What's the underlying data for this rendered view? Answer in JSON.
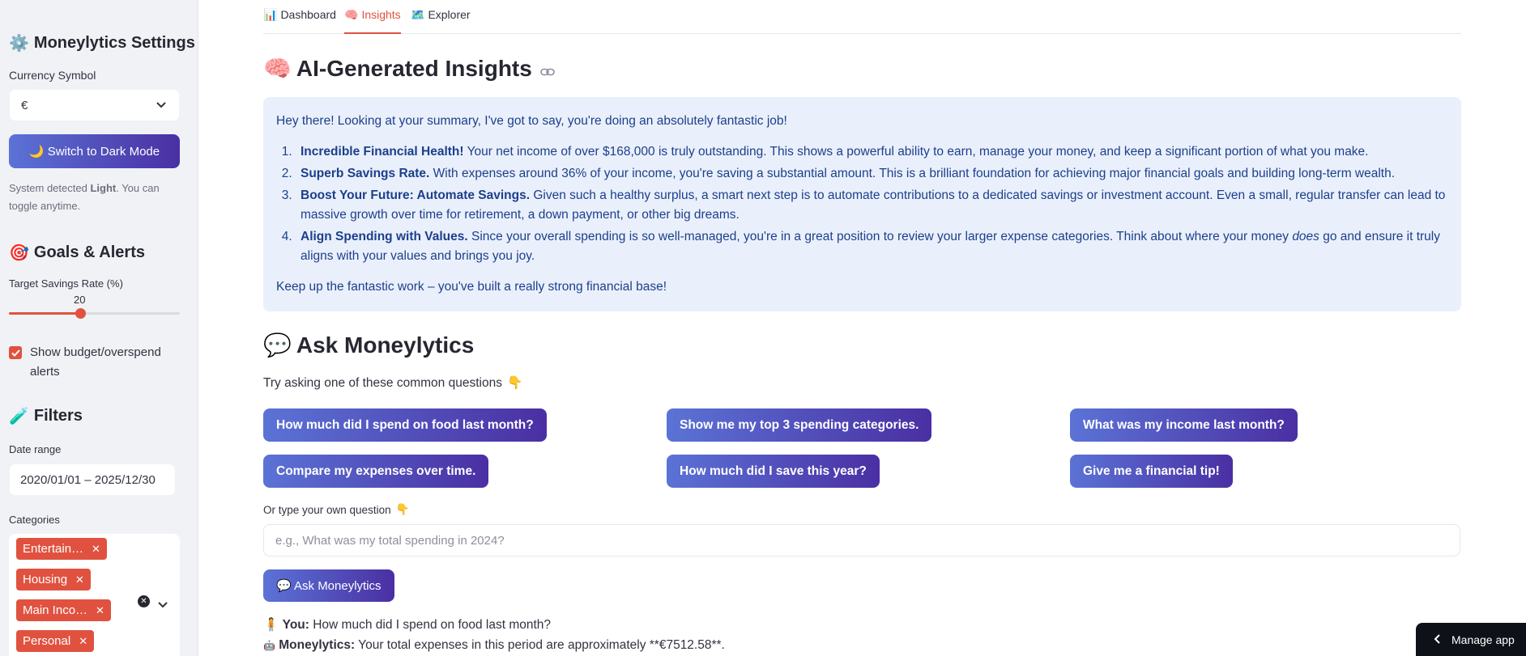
{
  "sidebar": {
    "settings_title": "Moneylytics Settings",
    "currency_label": "Currency Symbol",
    "currency_value": "€",
    "dark_mode_button": "🌙 Switch to Dark Mode",
    "system_text_pre": "System detected ",
    "system_text_bold": "Light",
    "system_text_post": ". You can toggle anytime.",
    "goals_title": "Goals & Alerts",
    "savings_label": "Target Savings Rate (%)",
    "savings_value": "20",
    "savings_fraction": 0.2,
    "alerts_label": "Show budget/overspend alerts",
    "alerts_checked": true,
    "filters_title": "Filters",
    "date_label": "Date range",
    "date_value": "2020/01/01 – 2025/12/30",
    "categories_label": "Categories",
    "categories": [
      "Entertain…",
      "Housing",
      "Main Inco…",
      "Personal"
    ]
  },
  "tabs": [
    {
      "icon": "📊",
      "label": "Dashboard"
    },
    {
      "icon": "🧠",
      "label": "Insights"
    },
    {
      "icon": "🗺️",
      "label": "Explorer"
    }
  ],
  "insights": {
    "title": "AI-Generated Insights",
    "intro": "Hey there! Looking at your summary, I've got to say, you're doing an absolutely fantastic job!",
    "items": [
      {
        "bold": "Incredible Financial Health!",
        "text": " Your net income of over $168,000 is truly outstanding. This shows a powerful ability to earn, manage your money, and keep a significant portion of what you make."
      },
      {
        "bold": "Superb Savings Rate.",
        "text": " With expenses around 36% of your income, you're saving a substantial amount. This is a brilliant foundation for achieving major financial goals and building long-term wealth."
      },
      {
        "bold": "Boost Your Future: Automate Savings.",
        "text": " Given such a healthy surplus, a smart next step is to automate contributions to a dedicated savings or investment account. Even a small, regular transfer can lead to massive growth over time for retirement, a down payment, or other big dreams."
      },
      {
        "bold": "Align Spending with Values.",
        "text_pre": " Since your overall spending is so well-managed, you're in a great position to review your larger expense categories. Think about where your money ",
        "em": "does",
        "text_post": " go and ensure it truly aligns with your values and brings you joy."
      }
    ],
    "closing": "Keep up the fantastic work – you've built a really strong financial base!"
  },
  "ask": {
    "title": "Ask Moneylytics",
    "prompt_text": "Try asking one of these common questions",
    "questions": [
      "How much did I spend on food last month?",
      "Show me my top 3 spending categories.",
      "What was my income last month?",
      "Compare my expenses over time.",
      "How much did I save this year?",
      "Give me a financial tip!"
    ],
    "custom_label": "Or type your own question",
    "placeholder": "e.g., What was my total spending in 2024?",
    "ask_button": "💬 Ask Moneylytics",
    "chat": {
      "you_label": "You:",
      "you_text": " How much did I spend on food last month?",
      "bot_label": "Moneylytics:",
      "bot_text": " Your total expenses in this period are approximately **€7512.58**."
    }
  },
  "footer": {
    "manage_app": "Manage app"
  }
}
